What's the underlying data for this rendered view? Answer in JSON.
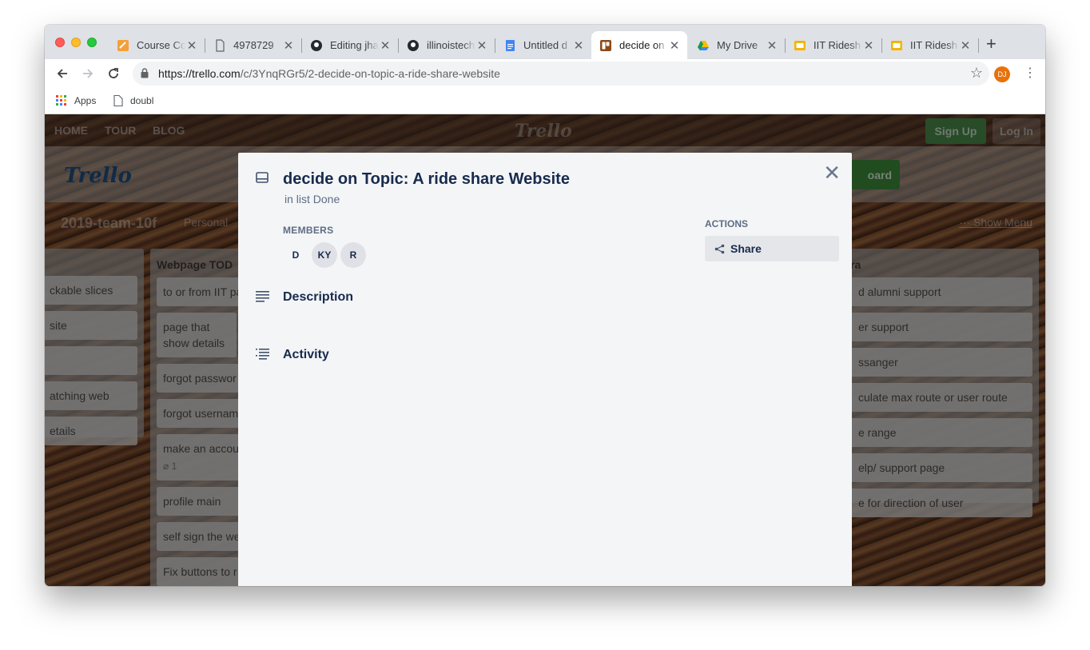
{
  "browser": {
    "tabs": [
      {
        "title": "Course Co",
        "favicon": "course-icon"
      },
      {
        "title": "4978729",
        "favicon": "doc-page-icon"
      },
      {
        "title": "Editing jha",
        "favicon": "github-icon"
      },
      {
        "title": "illinoistech",
        "favicon": "github-icon"
      },
      {
        "title": "Untitled d",
        "favicon": "google-docs-icon"
      },
      {
        "title": "decide on",
        "favicon": "trello-icon"
      },
      {
        "title": "My Drive",
        "favicon": "google-drive-icon"
      },
      {
        "title": "IIT Ridesh",
        "favicon": "google-slides-icon"
      },
      {
        "title": "IIT Ridesh",
        "favicon": "google-slides-icon"
      }
    ],
    "url_domain": "https://trello.com",
    "url_path": "/c/3YnqRGr5/2-decide-on-topic-a-ride-share-website",
    "profile_initials": "DJ",
    "bookmarks": [
      {
        "label": "Apps",
        "icon": "apps-grid-icon"
      },
      {
        "label": "doubl",
        "icon": "page-icon"
      }
    ]
  },
  "site_nav": {
    "links": [
      "HOME",
      "TOUR",
      "BLOG"
    ],
    "logo": "Trello",
    "sign_up": "Sign Up",
    "log_in": "Log In"
  },
  "board": {
    "logo": "Trello",
    "cta_partial": "oard",
    "name": "2019-team-10f",
    "visibility": "Personal",
    "show_menu": "Show Menu",
    "lists": [
      {
        "header": "",
        "cards": [
          "ckable slices",
          "site",
          "",
          "atching web",
          "etails"
        ]
      },
      {
        "header": "Webpage TOD",
        "cards": [
          "to or from IIT pa",
          "page that show details",
          "forgot passwor",
          "forgot usernam",
          "make an accou",
          "profile main",
          "self sign the we",
          "Fix buttons to r"
        ],
        "attachment_count": "1"
      },
      {
        "header": "ra",
        "cards": [
          "d alumni support",
          "er support",
          "ssanger",
          "culate max route or user route",
          "e range",
          "elp/ support page",
          "e for direction of user"
        ]
      }
    ]
  },
  "card_modal": {
    "title": "decide on Topic: A ride share Website",
    "in_list": "in list Done",
    "members_heading": "MEMBERS",
    "members": [
      "D",
      "KY",
      "R"
    ],
    "actions_heading": "ACTIONS",
    "share_label": "Share",
    "description_heading": "Description",
    "activity_heading": "Activity"
  }
}
